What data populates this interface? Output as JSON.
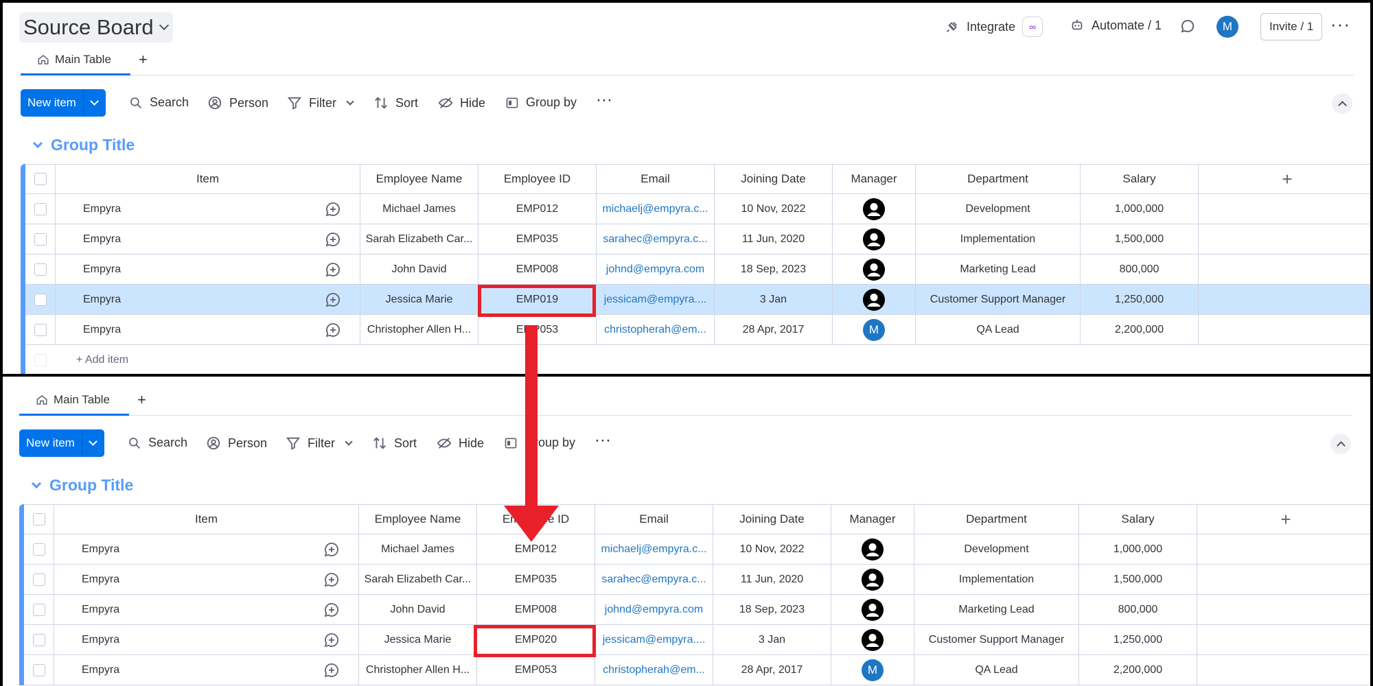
{
  "header": {
    "board_title": "Source Board",
    "integrate_label": "Integrate",
    "automate_label": "Automate / 1",
    "avatar_initial": "M",
    "invite_label": "Invite / 1"
  },
  "tabs": {
    "main_table": "Main Table",
    "add": "+"
  },
  "toolbar": {
    "new_item": "New item",
    "search": "Search",
    "person": "Person",
    "filter": "Filter",
    "sort": "Sort",
    "hide": "Hide",
    "group_by": "Group by",
    "more": "···"
  },
  "group": {
    "title": "Group Title",
    "columns": [
      "Item",
      "Employee Name",
      "Employee ID",
      "Email",
      "Joining Date",
      "Manager",
      "Department",
      "Salary"
    ],
    "add_item": "+ Add item"
  },
  "top_rows": [
    {
      "item": "Empyra",
      "name": "Michael James",
      "id": "EMP012",
      "email": "michaelj@empyra.c...",
      "date": "10 Nov, 2022",
      "manager": "person",
      "dept": "Development",
      "salary": "1,000,000"
    },
    {
      "item": "Empyra",
      "name": "Sarah Elizabeth Car...",
      "id": "EMP035",
      "email": "sarahec@empyra.c...",
      "date": "11 Jun, 2020",
      "manager": "person",
      "dept": "Implementation",
      "salary": "1,500,000"
    },
    {
      "item": "Empyra",
      "name": "John David",
      "id": "EMP008",
      "email": "johnd@empyra.com",
      "date": "18 Sep, 2023",
      "manager": "person",
      "dept": "Marketing Lead",
      "salary": "800,000"
    },
    {
      "item": "Empyra",
      "name": "Jessica Marie",
      "id": "EMP019",
      "email": "jessicam@empyra....",
      "date": "3 Jan",
      "manager": "person",
      "dept": "Customer Support Manager",
      "salary": "1,250,000"
    },
    {
      "item": "Empyra",
      "name": "Christopher Allen H...",
      "id": "EMP053",
      "email": "christopherah@em...",
      "date": "28 Apr, 2017",
      "manager": "M",
      "dept": "QA Lead",
      "salary": "2,200,000"
    }
  ],
  "bottom_rows": [
    {
      "item": "Empyra",
      "name": "Michael James",
      "id": "EMP012",
      "email": "michaelj@empyra.c...",
      "date": "10 Nov, 2022",
      "manager": "person",
      "dept": "Development",
      "salary": "1,000,000"
    },
    {
      "item": "Empyra",
      "name": "Sarah Elizabeth Car...",
      "id": "EMP035",
      "email": "sarahec@empyra.c...",
      "date": "11 Jun, 2020",
      "manager": "person",
      "dept": "Implementation",
      "salary": "1,500,000"
    },
    {
      "item": "Empyra",
      "name": "John David",
      "id": "EMP008",
      "email": "johnd@empyra.com",
      "date": "18 Sep, 2023",
      "manager": "person",
      "dept": "Marketing Lead",
      "salary": "800,000"
    },
    {
      "item": "Empyra",
      "name": "Jessica Marie",
      "id": "EMP020",
      "email": "jessicam@empyra....",
      "date": "3 Jan",
      "manager": "person",
      "dept": "Customer Support Manager",
      "salary": "1,250,000"
    },
    {
      "item": "Empyra",
      "name": "Christopher Allen H...",
      "id": "EMP053",
      "email": "christopherah@em...",
      "date": "28 Apr, 2017",
      "manager": "M",
      "dept": "QA Lead",
      "salary": "2,200,000"
    }
  ],
  "colors": {
    "accent": "#0073ea",
    "group": "#579bfc",
    "highlight": "#e8202a",
    "selected_row": "#cce5ff"
  }
}
